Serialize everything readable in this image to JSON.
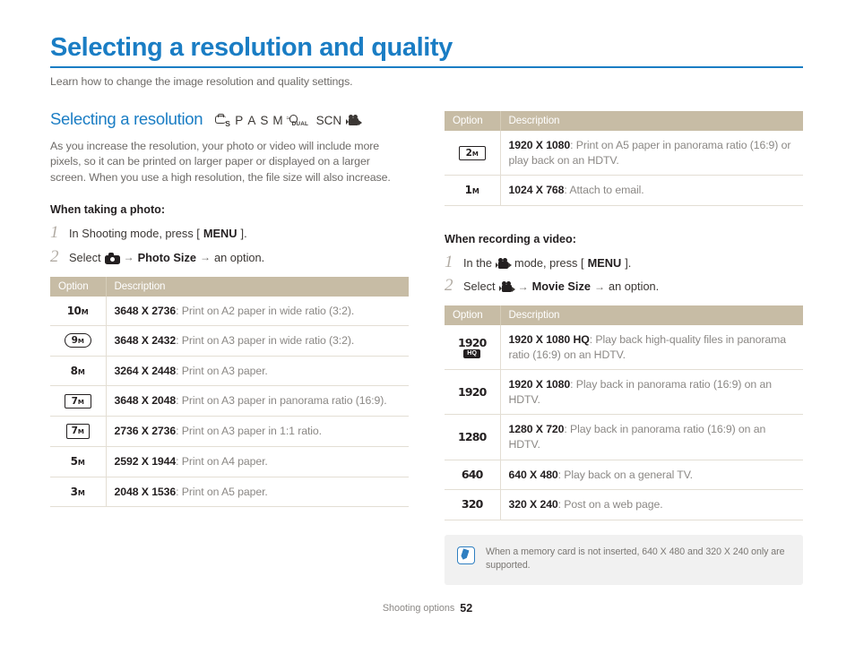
{
  "title": "Selecting a resolution and quality",
  "subtitle": "Learn how to change the image resolution and quality settings.",
  "footer": {
    "label": "Shooting options",
    "page": "52"
  },
  "section": {
    "heading": "Selecting a resolution",
    "modes": [
      "Smart Auto",
      "P",
      "A",
      "S",
      "M",
      "DUAL",
      "SCN",
      "Movie"
    ],
    "mode_letters": {
      "p": "P",
      "a": "A",
      "s": "S",
      "m": "M",
      "scn": "SCN",
      "dual": "DUAL",
      "smart_s": "S"
    },
    "body": "As you increase the resolution, your photo or video will include more pixels, so it can be printed on larger paper or displayed on a larger screen. When you use a high resolution, the file size will also increase."
  },
  "photo": {
    "when_label": "When taking a photo:",
    "steps": [
      {
        "num": "1",
        "pre": "In Shooting mode, press [",
        "bold": "MENU",
        "post": "]."
      },
      {
        "num": "2",
        "pre": "Select",
        "bold": "Photo Size",
        "post": "an option.",
        "arrow": "→"
      }
    ],
    "table": {
      "headers": {
        "option": "Option",
        "description": "Description"
      },
      "rows": [
        {
          "icon_num": "10",
          "icon_unit": "M",
          "icon_style": "plain",
          "res": "3648 X 2736",
          "desc": ": Print on A2 paper in wide ratio (3:2)."
        },
        {
          "icon_num": "9",
          "icon_unit": "M",
          "icon_style": "round",
          "res": "3648 X 2432",
          "desc": ": Print on A3 paper in wide ratio (3:2)."
        },
        {
          "icon_num": "8",
          "icon_unit": "M",
          "icon_style": "plain",
          "res": "3264 X 2448",
          "desc": ": Print on A3 paper."
        },
        {
          "icon_num": "7",
          "icon_unit": "M",
          "icon_style": "wide",
          "res": "3648 X 2048",
          "desc": ": Print on A3 paper in panorama ratio (16:9)."
        },
        {
          "icon_num": "7",
          "icon_unit": "M",
          "icon_style": "sq",
          "res": "2736 X 2736",
          "desc": ": Print on A3 paper in 1:1 ratio."
        },
        {
          "icon_num": "5",
          "icon_unit": "M",
          "icon_style": "plain",
          "res": "2592 X 1944",
          "desc": ": Print on A4 paper."
        },
        {
          "icon_num": "3",
          "icon_unit": "M",
          "icon_style": "plain",
          "res": "2048 X 1536",
          "desc": ": Print on A5 paper."
        }
      ]
    }
  },
  "photo_cont": {
    "table": {
      "headers": {
        "option": "Option",
        "description": "Description"
      },
      "rows": [
        {
          "icon_num": "2",
          "icon_unit": "M",
          "icon_style": "wide",
          "res": "1920 X 1080",
          "desc": ": Print on A5 paper in panorama ratio (16:9) or play back on an HDTV."
        },
        {
          "icon_num": "1",
          "icon_unit": "M",
          "icon_style": "plain",
          "res": "1024 X 768",
          "desc": ": Attach to email."
        }
      ]
    }
  },
  "video": {
    "when_label": "When recording a video:",
    "steps": [
      {
        "num": "1",
        "pre": "In the",
        "mid": "mode, press [",
        "bold": "MENU",
        "post": "]."
      },
      {
        "num": "2",
        "pre": "Select",
        "bold": "Movie Size",
        "post": "an option.",
        "arrow": "→"
      }
    ],
    "table": {
      "headers": {
        "option": "Option",
        "description": "Description"
      },
      "rows": [
        {
          "icon_num": "1920",
          "icon_badge": "HQ",
          "res": "1920 X 1080 HQ",
          "desc": ": Play back high-quality files in panorama ratio (16:9) on an HDTV."
        },
        {
          "icon_num": "1920",
          "icon_badge": "",
          "res": "1920 X 1080",
          "desc": ": Play back in panorama ratio (16:9) on an HDTV."
        },
        {
          "icon_num": "1280",
          "icon_badge": "",
          "res": "1280 X 720",
          "desc": ": Play back in panorama ratio (16:9) on an HDTV."
        },
        {
          "icon_num": "640",
          "icon_badge": "",
          "res": "640 X 480",
          "desc": ": Play back on a general TV."
        },
        {
          "icon_num": "320",
          "icon_badge": "",
          "res": "320 X 240",
          "desc": ": Post on a web page."
        }
      ]
    },
    "note": "When a memory card is not inserted, 640 X 480 and 320 X 240 only are supported."
  },
  "colors": {
    "accent": "#1a7dc4",
    "table_header": "#c7bca5",
    "note_bg": "#f1f1f1",
    "body_text": "#6e6b68"
  }
}
